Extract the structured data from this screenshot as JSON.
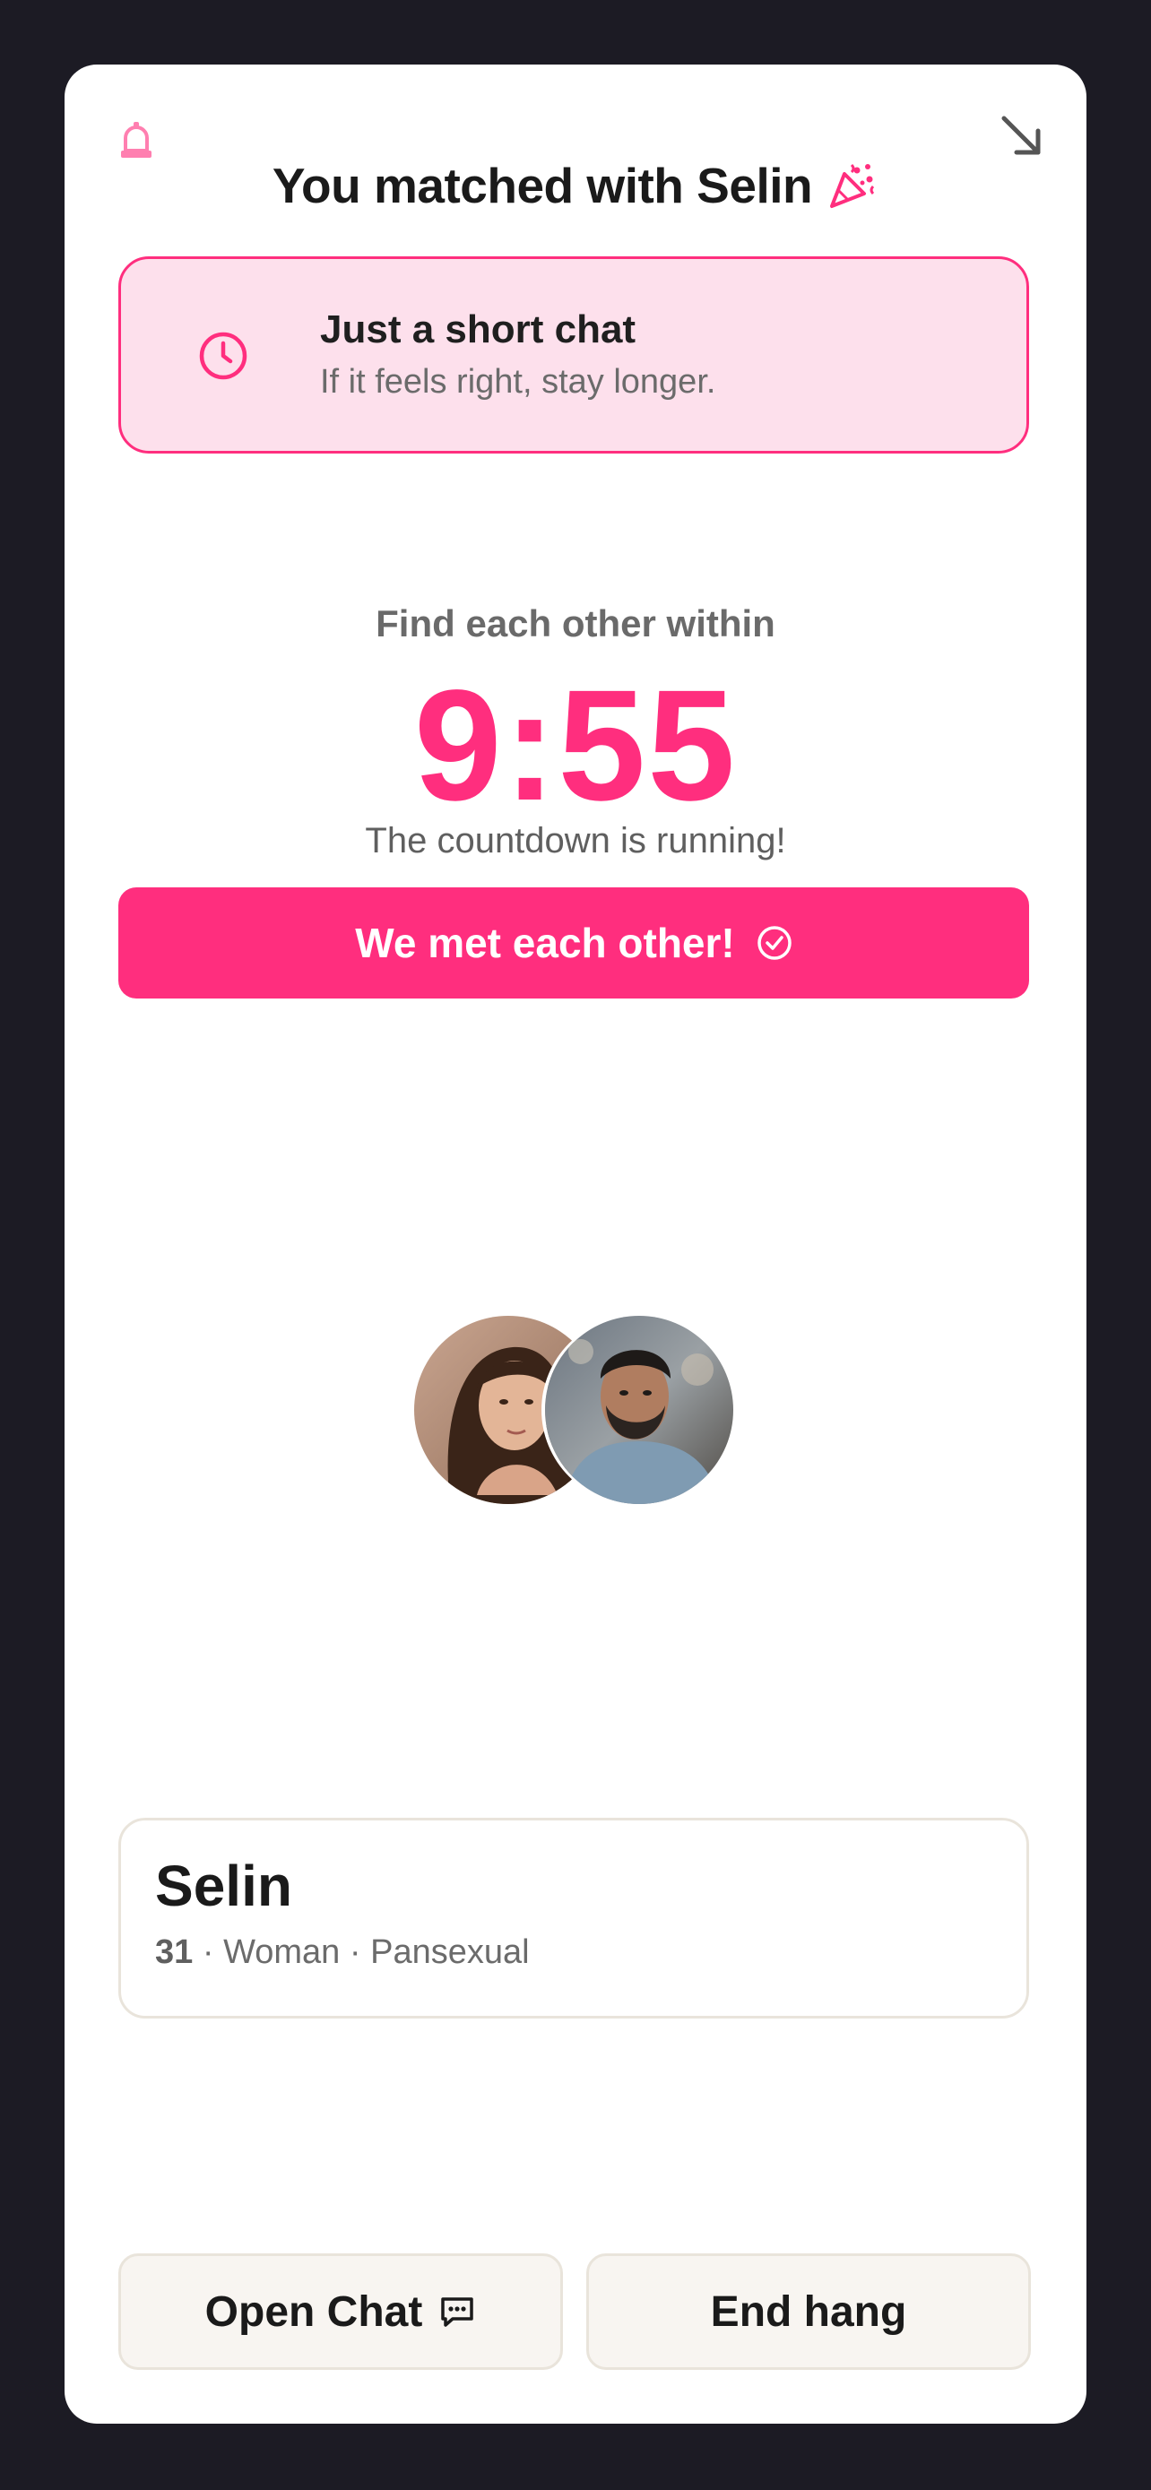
{
  "header": {
    "title_prefix": "You matched with ",
    "match_name": "Selin",
    "icons": {
      "left": "alarm-bell-icon",
      "right": "collapse-arrow-icon",
      "title": "party-popper-icon"
    }
  },
  "promo": {
    "icon": "clock-icon",
    "title": "Just a short chat",
    "subtitle": "If it feels right, stay longer."
  },
  "timer": {
    "label": "Find each other within",
    "value": "9:55",
    "status": "The countdown is running!"
  },
  "met_button": {
    "label": "We met each other!",
    "icon": "check-circle-icon"
  },
  "avatars": [
    {
      "description": "woman-avatar"
    },
    {
      "description": "man-avatar"
    }
  ],
  "profile": {
    "name": "Selin",
    "age": "31",
    "separator": " · ",
    "gender": "Woman",
    "orientation": "Pansexual"
  },
  "actions": {
    "open_chat": "Open Chat",
    "open_chat_icon": "chat-bubble-icon",
    "end_hang": "End hang"
  },
  "colors": {
    "accent": "#ff2e7e",
    "promo_bg": "#fde0ec",
    "background": "#1c1b24",
    "card": "#ffffff"
  }
}
